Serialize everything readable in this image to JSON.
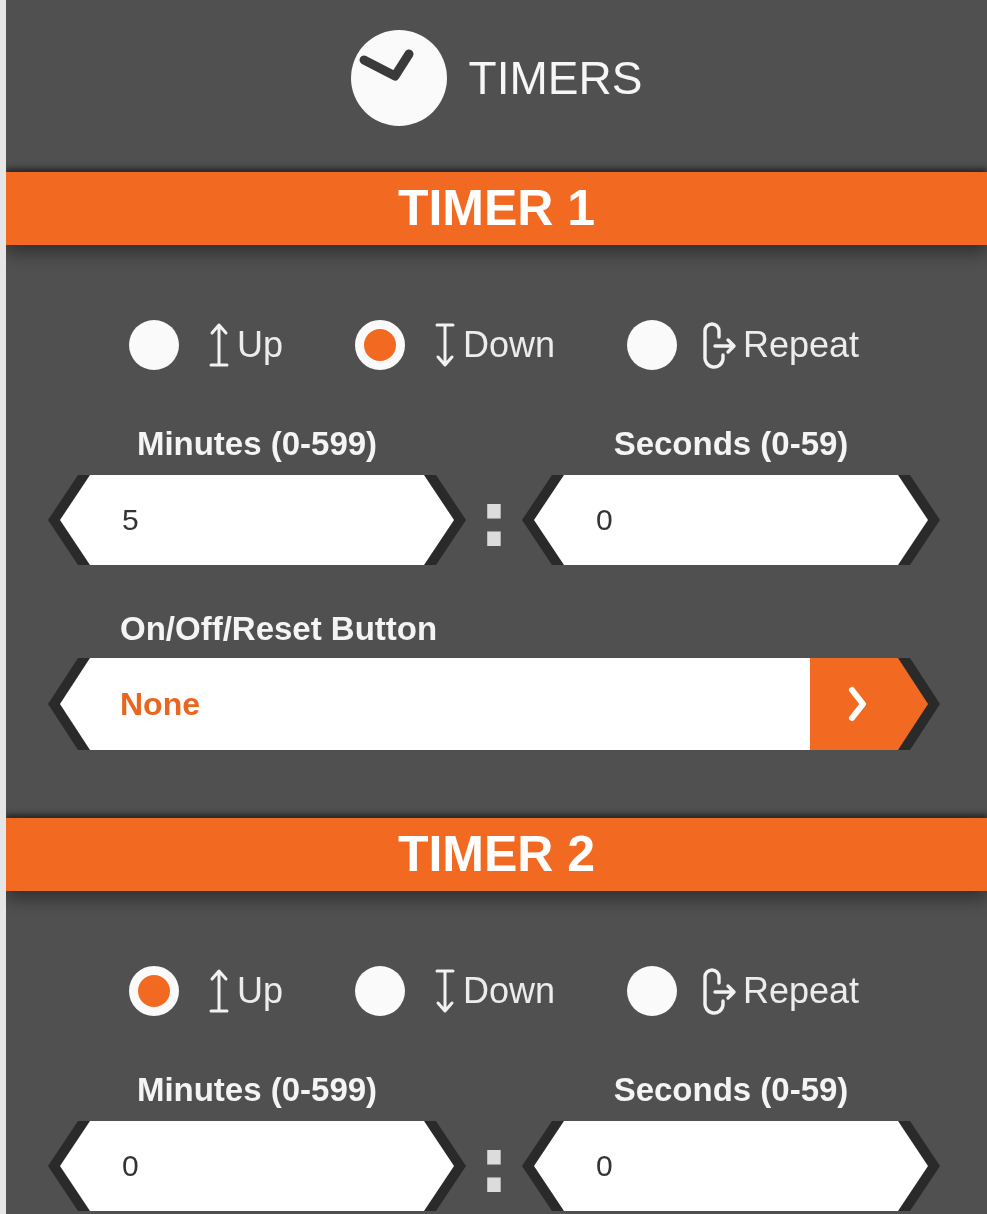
{
  "header": {
    "title": "TIMERS"
  },
  "timers": [
    {
      "title": "TIMER 1",
      "modes": [
        {
          "kind": "up",
          "label": "Up",
          "selected": false
        },
        {
          "kind": "down",
          "label": "Down",
          "selected": true
        },
        {
          "kind": "repeat",
          "label": "Repeat",
          "selected": false
        }
      ],
      "minutes": {
        "label": "Minutes (0-599)",
        "value": "5"
      },
      "separator": ":",
      "seconds": {
        "label": "Seconds (0-59)",
        "value": "0"
      },
      "reset_button": {
        "label": "On/Off/Reset Button",
        "value": "None"
      }
    },
    {
      "title": "TIMER 2",
      "modes": [
        {
          "kind": "up",
          "label": "Up",
          "selected": true
        },
        {
          "kind": "down",
          "label": "Down",
          "selected": false
        },
        {
          "kind": "repeat",
          "label": "Repeat",
          "selected": false
        }
      ],
      "minutes": {
        "label": "Minutes (0-599)",
        "value": "0"
      },
      "separator": ":",
      "seconds": {
        "label": "Seconds (0-59)",
        "value": "0"
      }
    }
  ]
}
